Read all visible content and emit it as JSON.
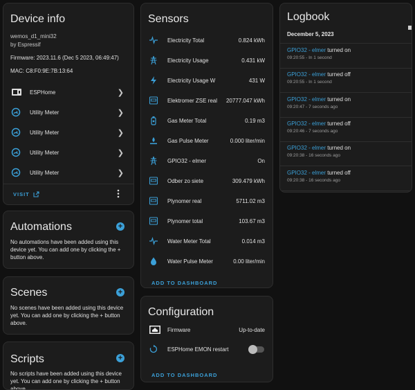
{
  "device": {
    "title": "Device info",
    "model": "wemos_d1_mini32",
    "manufacturer": "by Espressif",
    "firmware": "Firmware: 2023.11.6 (Dec 5 2023, 06:49:47)",
    "mac": "MAC: C8:F0:9E:7B:13:64",
    "integrations": [
      {
        "label": "ESPHome"
      },
      {
        "label": "Utility Meter"
      },
      {
        "label": "Utility Meter"
      },
      {
        "label": "Utility Meter"
      },
      {
        "label": "Utility Meter"
      }
    ],
    "visit_label": "VISIT"
  },
  "automations": {
    "title": "Automations",
    "text": "No automations have been added using this device yet. You can add one by clicking the + button above."
  },
  "scenes": {
    "title": "Scenes",
    "text": "No scenes have been added using this device yet. You can add one by clicking the + button above."
  },
  "scripts": {
    "title": "Scripts",
    "text": "No scripts have been added using this device yet. You can add one by clicking the + button above."
  },
  "sensors": {
    "title": "Sensors",
    "items": [
      {
        "name": "Electricity Total",
        "value": "0.824 kWh",
        "icon": "pulse-icon"
      },
      {
        "name": "Electricity Usage",
        "value": "0.431 kW",
        "icon": "transmission-tower-icon"
      },
      {
        "name": "Electricity Usage W",
        "value": "431 W",
        "icon": "flash-icon"
      },
      {
        "name": "Elektromer ZSE real",
        "value": "20777.047 kWh",
        "icon": "meter-icon"
      },
      {
        "name": "Gas Meter Total",
        "value": "0.19 m3",
        "icon": "gas-cylinder-icon"
      },
      {
        "name": "Gas Pulse Meter",
        "value": "0.000 liter/min",
        "icon": "gas-burner-icon"
      },
      {
        "name": "GPIO32 - elmer",
        "value": "On",
        "icon": "transmission-tower-icon"
      },
      {
        "name": "Odber zo siete",
        "value": "309.479 kWh",
        "icon": "meter-icon"
      },
      {
        "name": "Plynomer real",
        "value": "5711.02 m3",
        "icon": "meter-icon"
      },
      {
        "name": "Plynomer total",
        "value": "103.67 m3",
        "icon": "meter-icon"
      },
      {
        "name": "Water Meter Total",
        "value": "0.014 m3",
        "icon": "pulse-icon"
      },
      {
        "name": "Water Pulse Meter",
        "value": "0.00 liter/min",
        "icon": "water-drop-icon"
      }
    ],
    "add_label": "ADD TO DASHBOARD"
  },
  "configuration": {
    "title": "Configuration",
    "items": [
      {
        "name": "Firmware",
        "value": "Up-to-date",
        "icon": "chip-icon"
      },
      {
        "name": "ESPHome EMON restart",
        "value": "",
        "icon": "restart-icon"
      }
    ],
    "add_label": "ADD TO DASHBOARD"
  },
  "logbook": {
    "title": "Logbook",
    "date": "December 5, 2023",
    "entries": [
      {
        "entity": "GPIO32 - elmer",
        "action": "turned on",
        "time": "09:20:55 - In 1 second"
      },
      {
        "entity": "GPIO32 - elmer",
        "action": "turned off",
        "time": "09:20:55 - In 1 second"
      },
      {
        "entity": "GPIO32 - elmer",
        "action": "turned on",
        "time": "09:20:47 - 7 seconds ago"
      },
      {
        "entity": "GPIO32 - elmer",
        "action": "turned off",
        "time": "09:20:46 - 7 seconds ago"
      },
      {
        "entity": "GPIO32 - elmer",
        "action": "turned on",
        "time": "09:20:38 - 16 seconds ago"
      },
      {
        "entity": "GPIO32 - elmer",
        "action": "turned off",
        "time": "09:20:38 - 16 seconds ago"
      }
    ]
  },
  "colors": {
    "accent": "#3ba0d8",
    "background": "#111111",
    "card": "#1c1c1c"
  }
}
